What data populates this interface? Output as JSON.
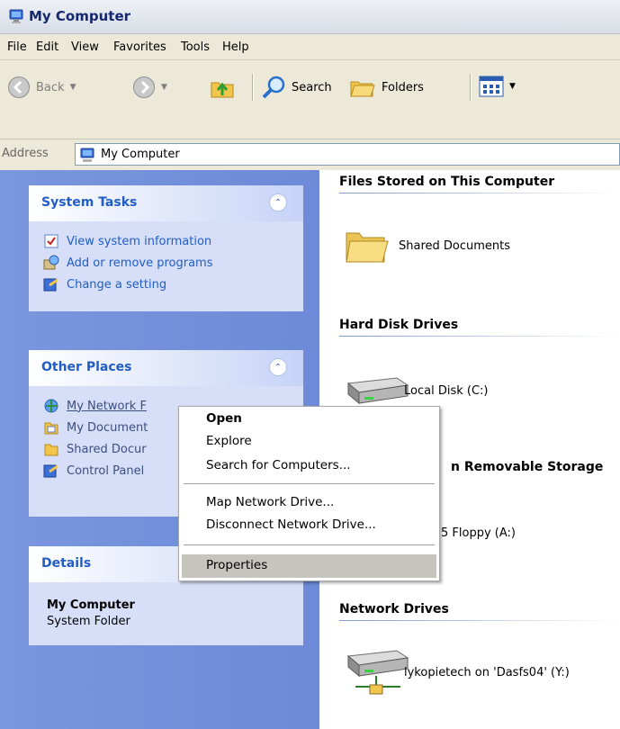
{
  "window": {
    "title": "My Computer"
  },
  "menu": [
    "File",
    "Edit",
    "View",
    "Favorites",
    "Tools",
    "Help"
  ],
  "toolbar": {
    "back": "Back",
    "search": "Search",
    "folders": "Folders"
  },
  "address": {
    "label": "Address",
    "value": "My Computer"
  },
  "system_tasks": {
    "title": "System Tasks",
    "items": [
      "View system information",
      "Add or remove programs",
      "Change a setting"
    ]
  },
  "other_places": {
    "title": "Other Places",
    "items": [
      "My Network F",
      "My Document",
      "Shared Docur",
      "Control Panel"
    ]
  },
  "details": {
    "title": "Details",
    "name": "My Computer",
    "subtitle": "System Folder"
  },
  "groups": {
    "files_stored": {
      "title": "Files Stored on This Computer",
      "items": [
        "Shared Documents"
      ]
    },
    "hard_disks": {
      "title": "Hard Disk Drives",
      "items": [
        "Local Disk (C:)"
      ]
    },
    "removable": {
      "title": "n Removable Storage",
      "items": [
        "5 Floppy (A:)"
      ]
    },
    "network": {
      "title": "Network Drives",
      "items": [
        "lykopietech on 'Dasfs04' (Y:)"
      ]
    }
  },
  "context_menu": {
    "open": "Open",
    "explore": "Explore",
    "search": "Search for Computers...",
    "map": "Map Network Drive...",
    "disconnect": "Disconnect Network Drive...",
    "properties": "Properties"
  },
  "colors": {
    "left_pane": "#7a96df",
    "link": "#215dc6",
    "highlight": "#c5c4bd"
  }
}
